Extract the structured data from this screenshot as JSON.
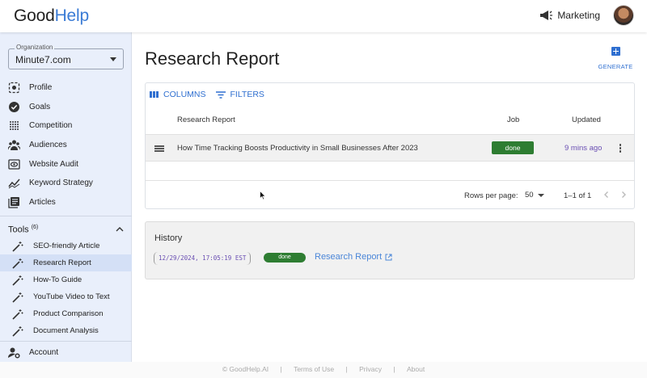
{
  "app": {
    "logo_part1": "Good",
    "logo_part2": "Help"
  },
  "topbar": {
    "workspace": "Marketing",
    "workspace_icon": "megaphone-icon"
  },
  "sidebar": {
    "org_label": "Organization",
    "org_value": "Minute7.com",
    "nav": [
      {
        "label": "Profile",
        "icon": "profile-icon"
      },
      {
        "label": "Goals",
        "icon": "check-circle-icon"
      },
      {
        "label": "Competition",
        "icon": "grid-dots-icon"
      },
      {
        "label": "Audiences",
        "icon": "users-icon"
      },
      {
        "label": "Website Audit",
        "icon": "eye-icon"
      },
      {
        "label": "Keyword Strategy",
        "icon": "chart-line-icon"
      },
      {
        "label": "Articles",
        "icon": "articles-icon"
      }
    ],
    "tools_title": "Tools",
    "tools_count": "(6)",
    "tools": [
      {
        "label": "SEO-friendly Article"
      },
      {
        "label": "Research Report"
      },
      {
        "label": "How-To Guide"
      },
      {
        "label": "YouTube Video to Text"
      },
      {
        "label": "Product Comparison"
      },
      {
        "label": "Document Analysis"
      }
    ],
    "active_tool": "Research Report",
    "account": "Account"
  },
  "main": {
    "title": "Research Report",
    "generate_label": "GENERATE",
    "toolbar": {
      "columns": "COLUMNS",
      "filters": "FILTERS"
    },
    "columns": {
      "title": "Research Report",
      "job": "Job",
      "updated": "Updated"
    },
    "rows": [
      {
        "title": "How Time Tracking Boosts Productivity in Small Businesses After 2023",
        "job": "done",
        "updated": "9 mins ago"
      }
    ],
    "pager": {
      "rows_per_page_label": "Rows per page:",
      "rows_per_page": "50",
      "range": "1–1 of 1"
    }
  },
  "history": {
    "title": "History",
    "entries": [
      {
        "timestamp": "12/29/2024, 17:05:19 EST",
        "status": "done",
        "link": "Research Report"
      }
    ]
  },
  "footer": {
    "copyright": "© GoodHelp.AI",
    "links": [
      "Terms of Use",
      "Privacy",
      "About"
    ],
    "separator": "|"
  },
  "colors": {
    "accent": "#2f6fd0",
    "done": "#2e7d32",
    "sidebar_bg": "#e9effb",
    "active_tool_bg": "#d4e0f6",
    "timestamp": "#6a4fb3"
  }
}
